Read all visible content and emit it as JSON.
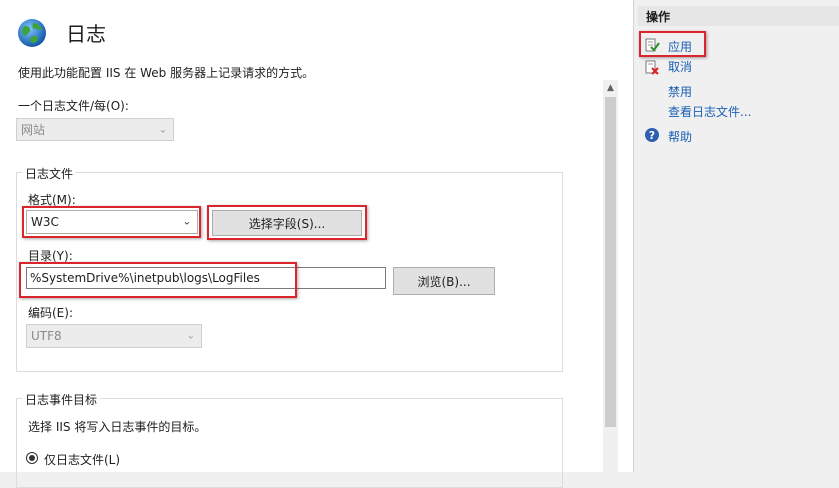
{
  "header": {
    "title": "日志",
    "description": "使用此功能配置 IIS 在 Web 服务器上记录请求的方式。"
  },
  "log_per": {
    "label": "一个日志文件/每(O):",
    "value": "网站"
  },
  "log_file_group": {
    "title": "日志文件",
    "format_label": "格式(M):",
    "format_value": "W3C",
    "select_fields_button": "选择字段(S)...",
    "directory_label": "目录(Y):",
    "directory_value": "%SystemDrive%\\inetpub\\logs\\LogFiles",
    "browse_button": "浏览(B)...",
    "encoding_label": "编码(E):",
    "encoding_value": "UTF8"
  },
  "event_target_group": {
    "title": "日志事件目标",
    "description": "选择 IIS 将写入日志事件的目标。",
    "radio_log_file_only": "仅日志文件(L)"
  },
  "actions": {
    "header": "操作",
    "apply": "应用",
    "cancel": "取消",
    "disable": "禁用",
    "view_logs": "查看日志文件...",
    "help": "帮助"
  },
  "colors": {
    "highlight_red": "#d9252b",
    "link_blue": "#1a5fb4"
  }
}
